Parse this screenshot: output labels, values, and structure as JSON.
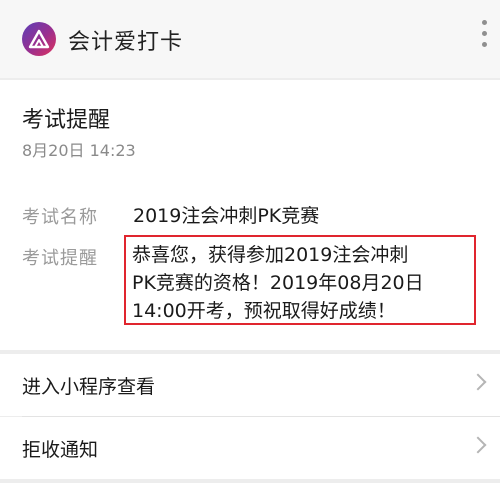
{
  "header": {
    "app_name": "会计爱打卡",
    "logo_icon": "triangle-logo-icon",
    "more_icon": "more-vertical-icon"
  },
  "message": {
    "title": "考试提醒",
    "time": "8月20日  14:23",
    "fields": [
      {
        "label": "考试名称",
        "value": "2019注会冲刺PK竞赛"
      },
      {
        "label": "考试提醒",
        "value_lines": [
          "恭喜您，获得参加2019注会冲刺",
          "PK竞赛的资格！2019年08月20日",
          "14:00开考，预祝取得好成绩！"
        ]
      }
    ]
  },
  "actions": [
    {
      "label": "进入小程序查看",
      "icon": "chevron-right-icon"
    },
    {
      "label": "拒收通知",
      "icon": "chevron-right-icon"
    }
  ],
  "colors": {
    "highlight_border": "#e0252e",
    "background": "#ededed",
    "card": "#ffffff"
  }
}
